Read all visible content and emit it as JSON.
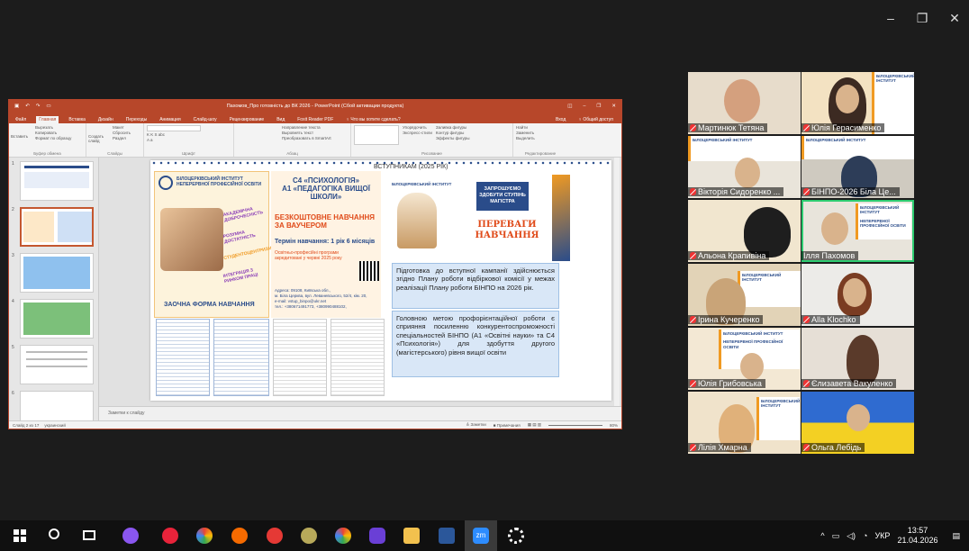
{
  "window_controls": {
    "minimize": "–",
    "restore": "❐",
    "close": "✕"
  },
  "ppt": {
    "title": "Пахомов_Про готовність до ВК 2026 - PowerPoint (Сбой активации продукта)",
    "window_buttons": [
      "◫",
      "–",
      "❐",
      "✕"
    ],
    "menu_tabs": [
      "Файл",
      "Главная",
      "Вставка",
      "Дизайн",
      "Переходы",
      "Анимация",
      "Слайд-шоу",
      "Рецензирование",
      "Вид",
      "Foxit Reader PDF",
      "♀ Что вы хотите сделать?"
    ],
    "menu_right": [
      "Вход",
      "♀ Общий доступ"
    ],
    "ribbon_groups": [
      {
        "label": "Буфер обмена",
        "items": [
          "Вырезать",
          "Копировать",
          "Формат по образцу",
          "Вставить"
        ]
      },
      {
        "label": "Слайды",
        "items": [
          "Создать слайд",
          "Макет",
          "Сбросить",
          "Раздел"
        ]
      },
      {
        "label": "Шрифт",
        "items": [
          "K K S abc",
          "A a"
        ]
      },
      {
        "label": "Абзац",
        "items": [
          "Направление текста",
          "Выровнять текст",
          "Преобразовать в SmartArt"
        ]
      },
      {
        "label": "Рисование",
        "items": [
          "Упорядочить",
          "Экспресс-стили",
          "Заливка фигуры",
          "Контур фигуры",
          "Эффекты фигуры"
        ]
      },
      {
        "label": "Редактирование",
        "items": [
          "Найти",
          "Заменить",
          "Выделить"
        ]
      }
    ],
    "thumb_numbers": [
      "1",
      "2",
      "3",
      "4",
      "5",
      "6"
    ],
    "notes_placeholder": "Заметки к слайду",
    "status_left": "Слайд 2 из 17",
    "status_lang": "украинский",
    "status_right": [
      "≙ Заметки",
      "■ Примечания",
      "80%"
    ]
  },
  "slide": {
    "header_small": "ВСТУПНИКАМ (2025 РІК)",
    "institute_name_1": "БІЛОЦЕРКІВСЬКИЙ ІНСТИТУТ",
    "institute_name_2": "НЕПЕРЕРВНОЇ ПРОФЕСІЙНОЇ ОСВІТИ",
    "tags": [
      "АКАДЕМІЧНА ДОБРОЧЕСНІСТЬ",
      "РОЗУМНА ДОСТАТНІСТЬ",
      "СТУДЕНТОЦЕНТРИЗМ",
      "ІНТЕГРАЦІЯ З РИНКОМ ПРАЦІ"
    ],
    "form_label": "ЗАОЧНА ФОРМА НАВЧАННЯ",
    "program_code": "С4 «ПСИХОЛОГІЯ»",
    "program_title": "А1 «ПЕДАГОГІКА ВИЩОЇ ШКОЛИ»",
    "free_study_1": "БЕЗКОШТОВНЕ НАВЧАННЯ",
    "free_study_2": "ЗА ВАУЧЕРОМ",
    "term": "Термін навчання: 1 рік 6 місяців",
    "accredited_1": "Освітньо-професійні програми",
    "accredited_2": "акредитовані у червні 2025 року",
    "address_1": "Адреса: 09108, Київська обл.,",
    "address_2": "м. Біла Церква, вул. Леваневського, 52/4, кім. 20,",
    "email": "e-mail: vstup_binpo@ukr.net",
    "phones": "тел.: +380671491773, +380990488102,",
    "invite_1": "ЗАПРОШУЄМО",
    "invite_2": "ЗДОБУТИ СТУПІНЬ",
    "invite_3": "МАГІСТРА",
    "benefits_1": "ПЕРЕВАГИ",
    "benefits_2": "НАВЧАННЯ",
    "text1": "Підготовка до вступної кампанії здійснюється згідно Плану роботи відбіркової комісії у межах реалізації Плану роботи БІНПО на 2026 рік.",
    "text2": "Головною метою профорієнтаційної роботи є сприяння посиленню конкурентоспроможності спеціальностей БІНПО (А1 «Освітні науки» та С4 «Психологія») для здобуття другого (магістерського) рівня вищої освіти"
  },
  "participants": [
    "Мартинюк Тетяна",
    "Юлія Герасименко",
    "Вікторія Сидоренко ...",
    "БІНПО-2026 Біла Це...",
    "Альона Крапивіна",
    "Ілля Пахомов",
    "Ірина Кучеренко",
    "Alla Klochko",
    "Юлія Грибовська",
    "Єлизавета Вакуленко",
    "Лілія Хмарна",
    "Ольга Лебідь"
  ],
  "tile_banner": [
    "БІЛОЦЕРКІВСЬКИЙ ІНСТИТУТ",
    "НЕПЕРЕРВНОЇ ПРОФЕСІЙНОЇ ОСВІТИ"
  ],
  "tray": {
    "lang": "УКР",
    "time": "13:57",
    "date": "21.04.2026"
  },
  "colors": {
    "ppt_red": "#b7472a",
    "orange": "#f09a22",
    "navy": "#2a4c8a",
    "active_speaker": "#2ecc71"
  }
}
